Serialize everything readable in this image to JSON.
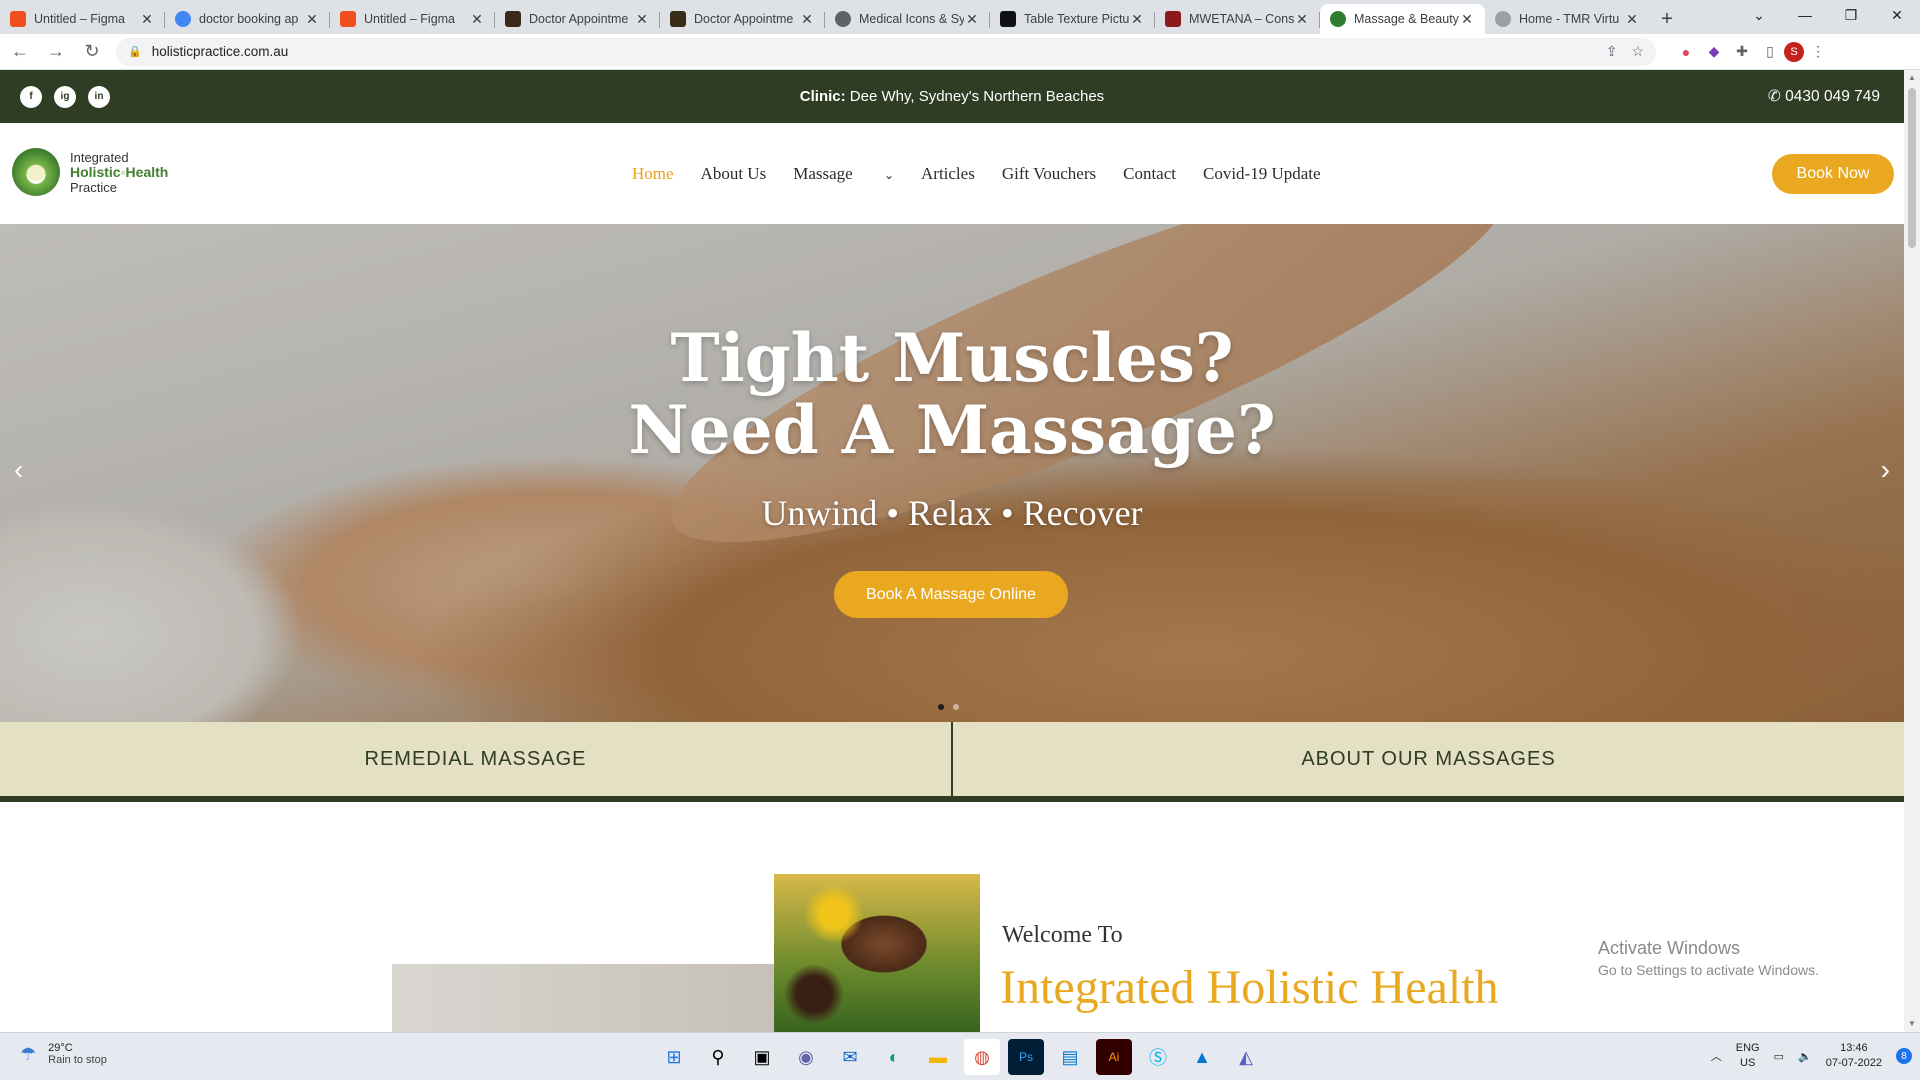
{
  "browser": {
    "tabs": [
      {
        "title": "Untitled – Figma",
        "color": "#f24e1e"
      },
      {
        "title": "doctor booking ap",
        "color": "#4285f4"
      },
      {
        "title": "Untitled – Figma",
        "color": "#f24e1e"
      },
      {
        "title": "Doctor Appointme",
        "color": "#3a2a1a"
      },
      {
        "title": "Doctor Appointme",
        "color": "#3a2a1a"
      },
      {
        "title": "Medical Icons & Sy",
        "color": "#5f6368"
      },
      {
        "title": "Table Texture Pictu",
        "color": "#111111"
      },
      {
        "title": "MWETANA – Cons",
        "color": "#8b1a1a"
      },
      {
        "title": "Massage & Beauty",
        "color": "#2e7d32"
      },
      {
        "title": "Home - TMR Virtu",
        "color": "#9aa0a6"
      }
    ],
    "new_tab": "+",
    "url": "holisticpractice.com.au",
    "profile_initial": "S"
  },
  "site": {
    "topstrip": {
      "social": [
        "f",
        "ig",
        "in"
      ],
      "clinic_label": "Clinic:",
      "clinic_text": " Dee Why, Sydney's Northern Beaches",
      "phone": "0430 049 749"
    },
    "logo": {
      "line1": "Integrated",
      "line2a": "Holistic",
      "line2b": "Health",
      "line3": "Practice"
    },
    "nav": {
      "home": "Home",
      "about": "About Us",
      "massage": "Massage",
      "articles": "Articles",
      "gift": "Gift Vouchers",
      "contact": "Contact",
      "covid": "Covid-19 Update",
      "book": "Book Now"
    },
    "hero": {
      "title_line1": "Tight Muscles?",
      "title_line2": "Need A Massage?",
      "subtitle": "Unwind • Relax • Recover",
      "cta": "Book A Massage Online",
      "prev": "‹",
      "next": "›"
    },
    "band": {
      "left": "REMEDIAL MASSAGE",
      "right": "ABOUT OUR MASSAGES"
    },
    "welcome": {
      "line1": "Welcome To",
      "line2": "Integrated Holistic Health"
    }
  },
  "watermark": {
    "title": "Activate Windows",
    "sub": "Go to Settings to activate Windows."
  },
  "taskbar": {
    "temp": "29°C",
    "weather": "Rain to stop",
    "lang1": "ENG",
    "lang2": "US",
    "time": "13:46",
    "date": "07-07-2022",
    "notif": "8"
  }
}
